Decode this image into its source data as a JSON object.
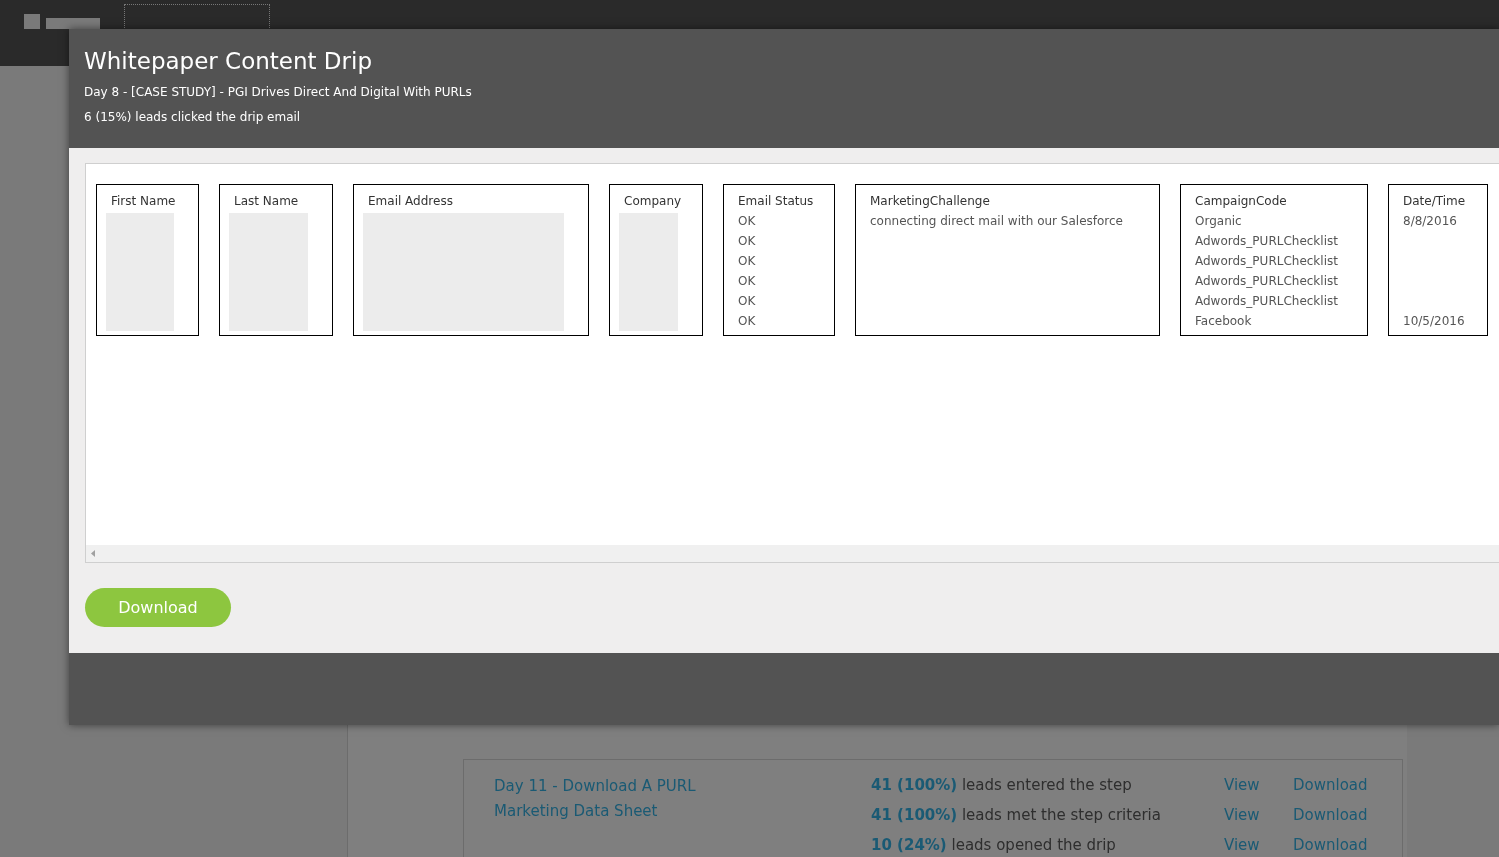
{
  "modal": {
    "title": "Whitepaper Content Drip",
    "subtitle": "Day 8 - [CASE STUDY] - PGI Drives Direct And Digital With PURLs",
    "summary": "6 (15%) leads clicked the drip email",
    "columns": [
      {
        "header": "First Name",
        "kind": "redacted"
      },
      {
        "header": "Last Name",
        "kind": "redacted"
      },
      {
        "header": "Email Address",
        "kind": "redacted"
      },
      {
        "header": "Company",
        "kind": "redacted"
      },
      {
        "header": "Email Status",
        "kind": "text",
        "values": [
          "OK",
          "OK",
          "OK",
          "OK",
          "OK",
          "OK"
        ]
      },
      {
        "header": "MarketingChallenge",
        "kind": "text",
        "values": [
          "connecting direct mail with our Salesforce"
        ]
      },
      {
        "header": "CampaignCode",
        "kind": "text",
        "values": [
          "Organic",
          "Adwords_PURLChecklist",
          "Adwords_PURLChecklist",
          "Adwords_PURLChecklist",
          "Adwords_PURLChecklist",
          "Facebook"
        ]
      },
      {
        "header": "Date/Time",
        "kind": "first_last",
        "values": [
          "8/8/2016",
          "10/5/2016"
        ]
      }
    ],
    "download_button": "Download"
  },
  "background_step": {
    "title": "Day 11 - Download A PURL Marketing Data Sheet",
    "stats": [
      {
        "count": "41 (100%)",
        "text": "leads entered the step",
        "view": "View",
        "download": "Download"
      },
      {
        "count": "41 (100%)",
        "text": "leads met the step criteria",
        "view": "View",
        "download": "Download"
      },
      {
        "count": "10 (24%)",
        "text": "leads opened the drip",
        "view": "View",
        "download": "Download"
      }
    ]
  }
}
